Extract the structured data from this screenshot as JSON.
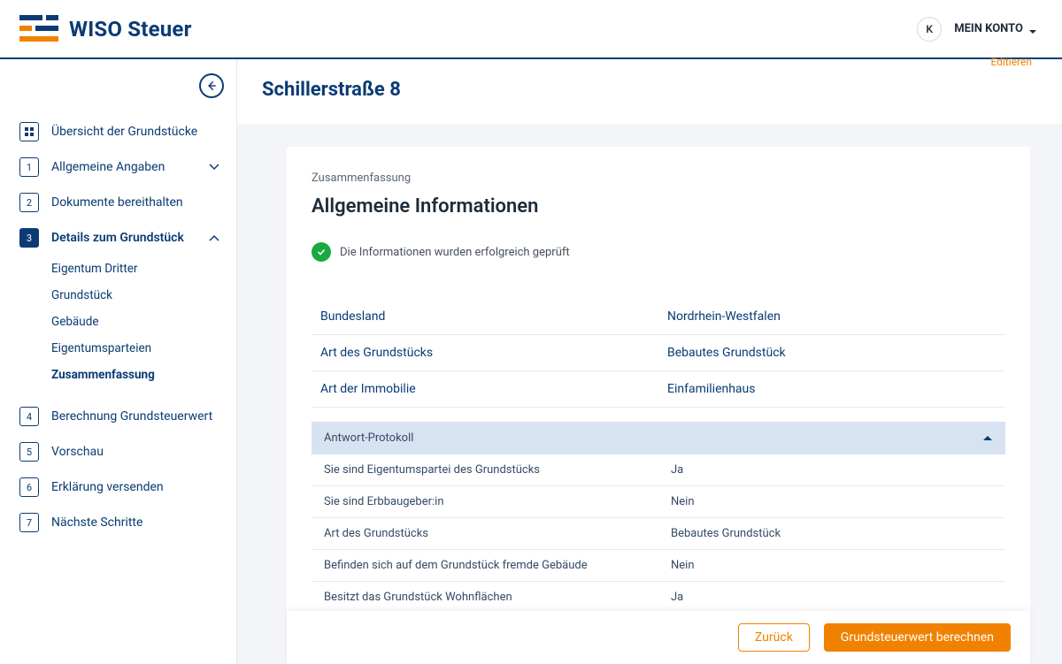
{
  "header": {
    "brand": "WISO Steuer",
    "avatar_initial": "K",
    "account_label": "MEIN KONTO",
    "editieren": "Editieren"
  },
  "sidebar": {
    "overview": "Übersicht der Grundstücke",
    "items": [
      {
        "num": "1",
        "label": "Allgemeine Angaben",
        "exp": "down"
      },
      {
        "num": "2",
        "label": "Dokumente bereithalten"
      },
      {
        "num": "3",
        "label": "Details zum Grundstück",
        "exp": "up",
        "active": true,
        "subs": [
          "Eigentum Dritter",
          "Grundstück",
          "Gebäude",
          "Eigentumsparteien",
          "Zusammenfassung"
        ],
        "current_sub": 4
      },
      {
        "num": "4",
        "label": "Berechnung Grundsteuerwert"
      },
      {
        "num": "5",
        "label": "Vorschau"
      },
      {
        "num": "6",
        "label": "Erklärung versenden"
      },
      {
        "num": "7",
        "label": "Nächste Schritte"
      }
    ]
  },
  "page": {
    "title": "Schillerstraße 8",
    "kicker": "Zusammenfassung",
    "heading": "Allgemeine Informationen",
    "status": "Die Informationen wurden erfolgreich geprüft",
    "info_rows": [
      {
        "k": "Bundesland",
        "v": "Nordrhein-Westfalen"
      },
      {
        "k": "Art des Grundstücks",
        "v": "Bebautes Grundstück"
      },
      {
        "k": "Art der Immobilie",
        "v": "Einfamilienhaus"
      }
    ],
    "protocol_title": "Antwort-Protokoll",
    "protocol_rows": [
      {
        "k": "Sie sind Eigentumspartei des Grundstücks",
        "v": "Ja"
      },
      {
        "k": "Sie sind Erbbaugeber:in",
        "v": "Nein"
      },
      {
        "k": "Art des Grundstücks",
        "v": "Bebautes Grundstück"
      },
      {
        "k": "Befinden sich auf dem Grundstück fremde Gebäude",
        "v": "Nein"
      },
      {
        "k": "Besitzt das Grundstück Wohnflächen",
        "v": "Ja"
      }
    ]
  },
  "footer": {
    "back": "Zurück",
    "primary": "Grundsteuerwert berechnen"
  }
}
